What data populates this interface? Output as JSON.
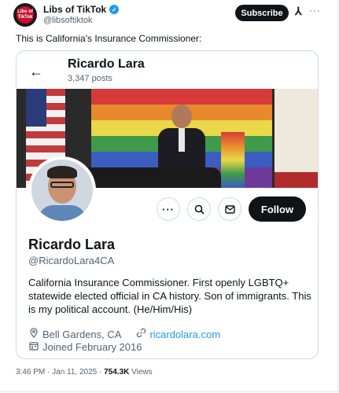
{
  "tweet": {
    "author_name": "Libs of TikTok",
    "author_handle": "@libsoftiktok",
    "avatar_text": "Libs of TikTok",
    "subscribe_label": "Subscribe",
    "text": "This is California's Insurance Commissioner:",
    "timestamp": "3:46 PM · Jan 11, 2025 · ",
    "views_count": "754.3K",
    "views_label": " Views"
  },
  "embedded_profile": {
    "header_name": "Ricardo Lara",
    "header_posts": "3,347 posts",
    "follow_label": "Follow",
    "display_name": "Ricardo Lara",
    "handle": "@RicardoLara4CA",
    "bio": "California Insurance Commissioner. First openly LGBTQ+ statewide elected official in CA history. Son of immigrants. This is my political account. (He/Him/His)",
    "location": "Bell Gardens, CA",
    "website": "ricardolara.com",
    "joined": "Joined February 2016"
  },
  "icons": {
    "verified": "verified-badge-icon",
    "grok": "grok-icon",
    "more": "more-icon",
    "back": "back-arrow-icon",
    "search": "search-icon",
    "message": "message-icon",
    "location": "location-pin-icon",
    "link": "link-icon",
    "calendar": "calendar-icon"
  },
  "colors": {
    "accent": "#1d9bf0",
    "text_primary": "#0f1419",
    "text_secondary": "#536471"
  }
}
